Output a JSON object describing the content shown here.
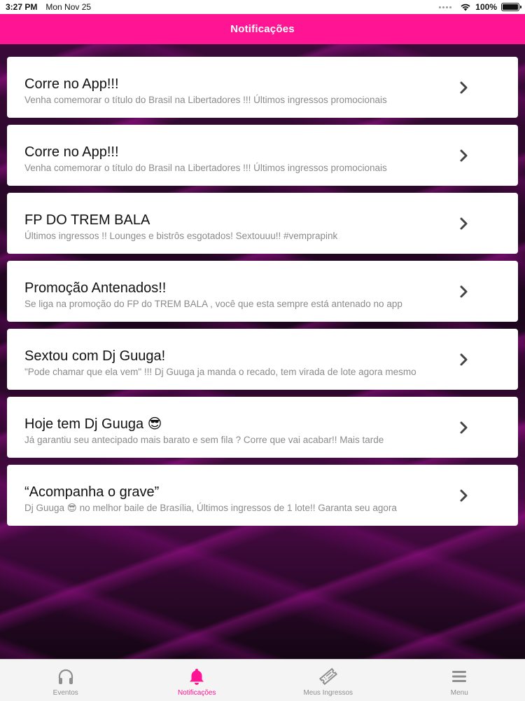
{
  "status_bar": {
    "time": "3:27 PM",
    "date": "Mon Nov 25",
    "battery": "100%"
  },
  "header": {
    "title": "Notificações"
  },
  "notifications": [
    {
      "title": "Corre no App!!!",
      "body": "Venha comemorar o título do Brasil na Libertadores !!! Últimos ingressos promocionais"
    },
    {
      "title": "Corre no App!!!",
      "body": "Venha comemorar o título do Brasil na Libertadores !!! Últimos ingressos promocionais"
    },
    {
      "title": "FP DO TREM BALA",
      "body": "Últimos ingressos !! Lounges e bistrôs esgotados! Sextouuu!! #vemprapink"
    },
    {
      "title": "Promoção Antenados!!",
      "body": "Se liga na promoção do FP do TREM BALA , você que esta sempre está antenado no app"
    },
    {
      "title": "Sextou com Dj Guuga!",
      "body": "\"Pode chamar que ela vem\" !!! Dj Guuga ja manda o recado, tem virada de lote agora mesmo"
    },
    {
      "title": "Hoje tem Dj Guuga 😎",
      "body": "Já garantiu seu antecipado mais barato e sem fila ? Corre que vai acabar!! Mais tarde"
    },
    {
      "title": "“Acompanha o grave”",
      "body": "Dj Guuga 😎 no melhor baile de Brasília,  Últimos ingressos de 1 lote!! Garanta seu agora"
    }
  ],
  "tabs": [
    {
      "label": "Eventos",
      "icon": "headphones-icon",
      "active": false
    },
    {
      "label": "Notificações",
      "icon": "bell-icon",
      "active": true
    },
    {
      "label": "Meus Ingressos",
      "icon": "ticket-icon",
      "active": false
    },
    {
      "label": "Menu",
      "icon": "menu-icon",
      "active": false
    }
  ],
  "colors": {
    "accent": "#ff1493",
    "inactive_tab": "#8e8e8e"
  }
}
